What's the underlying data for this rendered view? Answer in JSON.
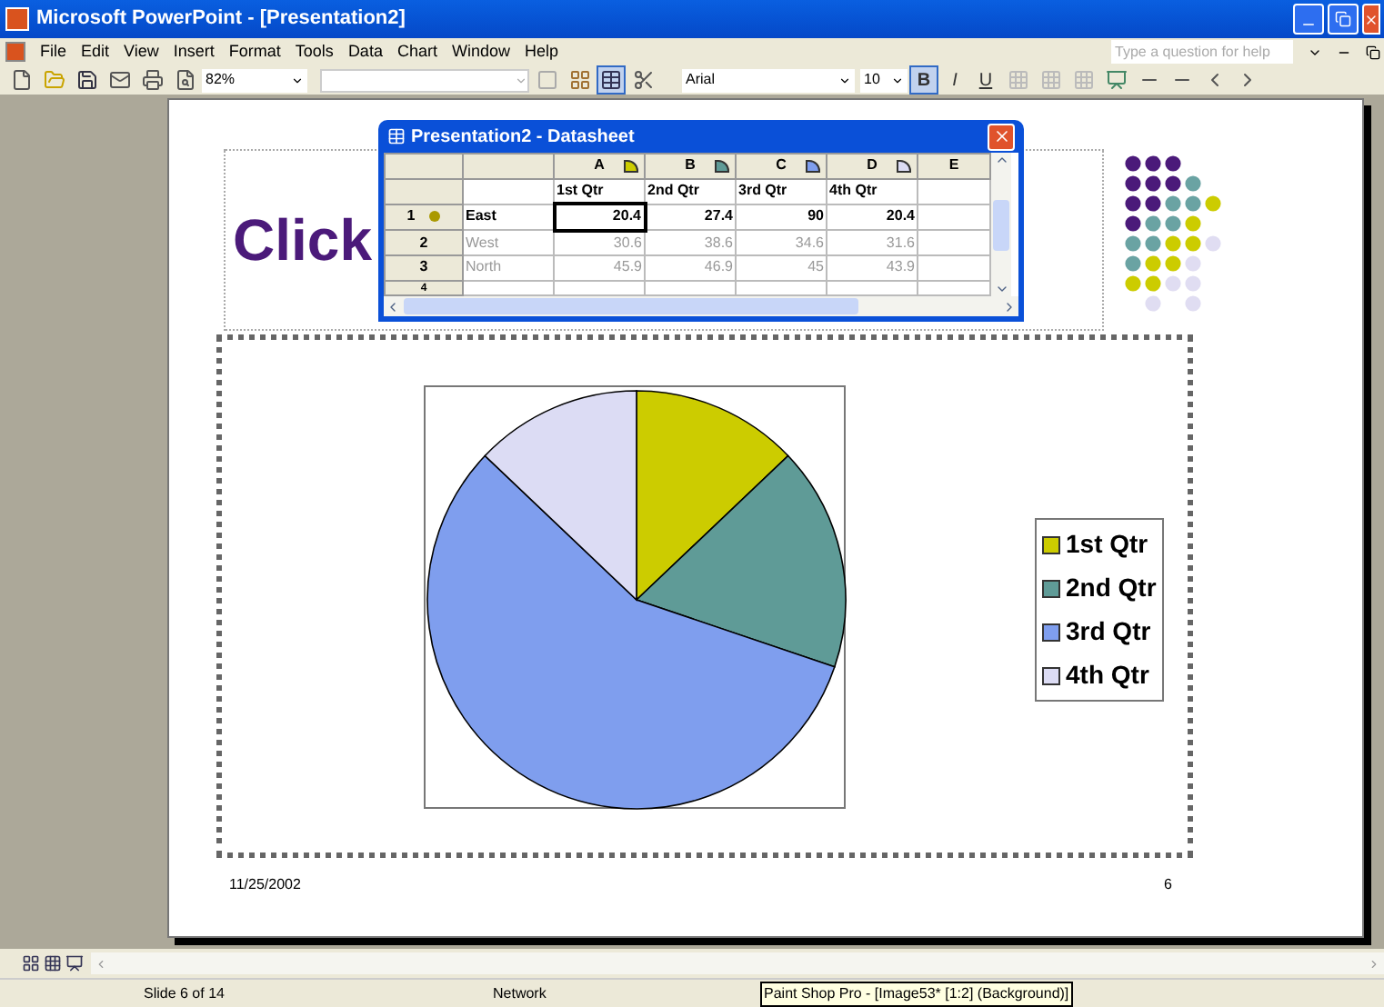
{
  "window": {
    "title": "Microsoft PowerPoint - [Presentation2]"
  },
  "menu": [
    "File",
    "Edit",
    "View",
    "Insert",
    "Format",
    "Tools",
    "Data",
    "Chart",
    "Window",
    "Help"
  ],
  "help_box": {
    "placeholder": "Type a question for help"
  },
  "toolbar": {
    "zoom": "82%",
    "font": "Arial",
    "font_size": "10",
    "datasheet_pressed": true,
    "format_buttons": [
      {
        "label": "B",
        "pressed": true
      },
      {
        "label": "I",
        "pressed": false
      },
      {
        "label": "U",
        "pressed": false
      }
    ]
  },
  "datasheet": {
    "title": "Presentation2 - Datasheet",
    "columns": [
      "A",
      "B",
      "C",
      "D",
      "E"
    ],
    "header_row": [
      "1st Qtr",
      "2nd Qtr",
      "3rd Qtr",
      "4th Qtr"
    ],
    "rows": [
      {
        "number": "1",
        "included": true,
        "name": "East",
        "cells": [
          {
            "text": "20.4",
            "selected": true
          },
          {
            "text": "27.4",
            "selected": false
          },
          {
            "text": "90",
            "selected": false
          },
          {
            "text": "20.4",
            "selected": false
          }
        ]
      },
      {
        "number": "2",
        "included": false,
        "name": "West",
        "cells": [
          {
            "text": "30.6",
            "selected": false
          },
          {
            "text": "38.6",
            "selected": false
          },
          {
            "text": "34.6",
            "selected": false
          },
          {
            "text": "31.6",
            "selected": false
          }
        ]
      },
      {
        "number": "3",
        "included": false,
        "name": "North",
        "cells": [
          {
            "text": "45.9",
            "selected": false
          },
          {
            "text": "46.9",
            "selected": false
          },
          {
            "text": "45",
            "selected": false
          },
          {
            "text": "43.9",
            "selected": false
          }
        ]
      }
    ],
    "empty_row_number": "4"
  },
  "slide": {
    "title": "Click",
    "date": "11/25/2002",
    "number": "6",
    "chart_data": {
      "type": "pie",
      "categories": [
        "1st Qtr",
        "2nd Qtr",
        "3rd Qtr",
        "4th Qtr"
      ],
      "series": [
        {
          "values": [
            12.9,
            17.3,
            56.9,
            12.9
          ]
        }
      ]
    },
    "legend": [
      {
        "color": "#cccc00"
      },
      {
        "color": "#5f9b97"
      },
      {
        "color": "#7f9eee"
      },
      {
        "color": "#dcdcf4"
      }
    ]
  },
  "status_bar": {
    "slide": "Slide 6 of 14",
    "network": "Network",
    "tooltip": "Paint Shop Pro - [Image53* [1:2] (Background)]"
  }
}
